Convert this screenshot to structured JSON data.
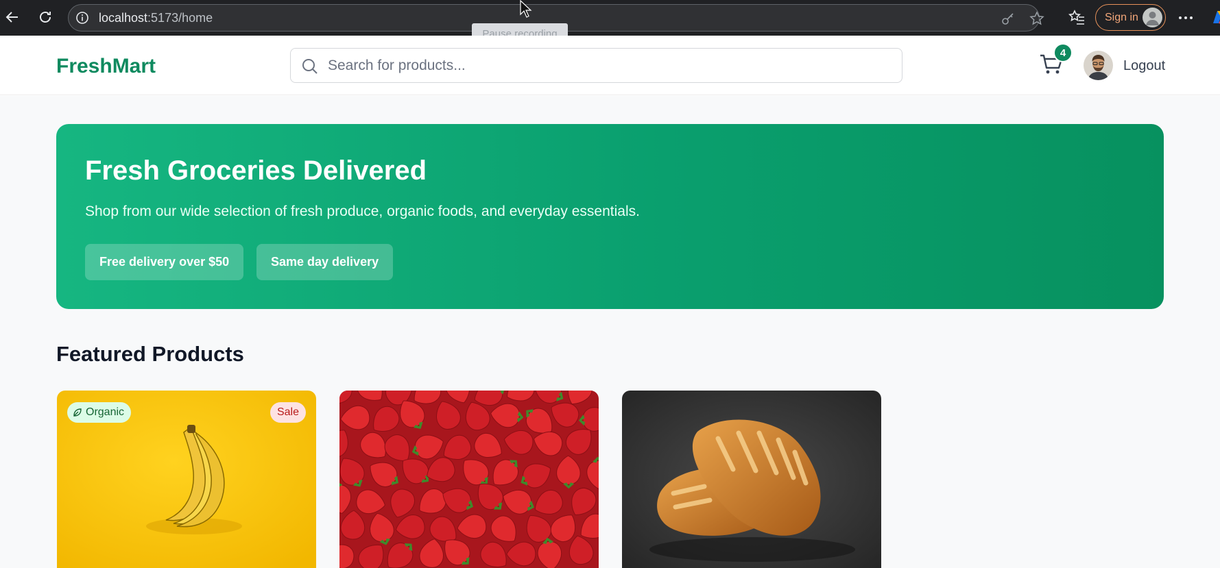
{
  "browser": {
    "url_host": "localhost",
    "url_rest": ":5173/home",
    "sign_in_label": "Sign in",
    "tooltip": "Pause recording"
  },
  "header": {
    "brand": "FreshMart",
    "search_placeholder": "Search for products...",
    "cart_count": "4",
    "logout_label": "Logout"
  },
  "hero": {
    "title": "Fresh Groceries Delivered",
    "subtitle": "Shop from our wide selection of fresh produce, organic foods, and everyday essentials.",
    "pills": [
      "Free delivery over $50",
      "Same day delivery"
    ]
  },
  "featured": {
    "title": "Featured Products",
    "products": [
      {
        "image": "bananas",
        "badge_left": "Organic",
        "badge_right": "Sale"
      },
      {
        "image": "strawberries"
      },
      {
        "image": "bread"
      }
    ]
  },
  "colors": {
    "brand": "#0f8a5f",
    "hero_start": "#16b681",
    "hero_end": "#07915f"
  }
}
